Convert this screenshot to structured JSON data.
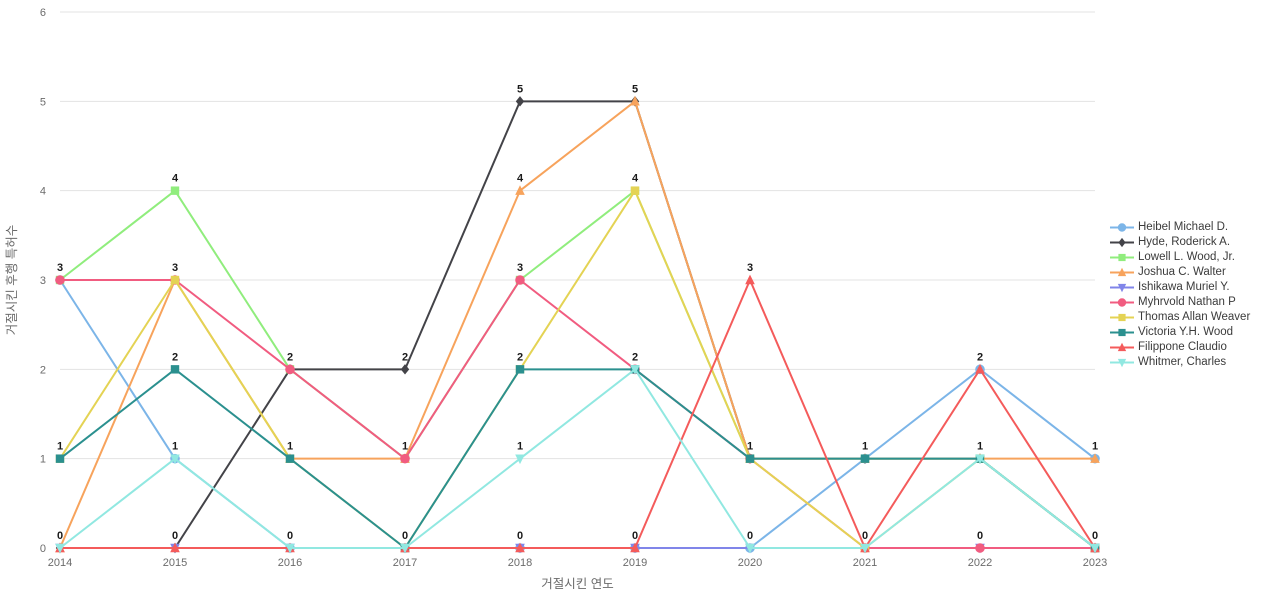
{
  "chart_data": {
    "type": "line",
    "title": "",
    "xlabel": "거절시킨 연도",
    "ylabel": "거절시킨 후행 특허수",
    "categories": [
      "2014",
      "2015",
      "2016",
      "2017",
      "2018",
      "2019",
      "2020",
      "2021",
      "2022",
      "2023"
    ],
    "ylim": [
      0,
      6
    ],
    "yticks": [
      0,
      1,
      2,
      3,
      4,
      5,
      6
    ],
    "grid": true,
    "legend_position": "right",
    "data_labels": true,
    "series": [
      {
        "name": "Heibel Michael D.",
        "color": "#7cb5e8",
        "marker": "circle",
        "values": [
          3,
          1,
          0,
          0,
          0,
          0,
          0,
          1,
          2,
          1
        ]
      },
      {
        "name": "Hyde, Roderick A.",
        "color": "#434348",
        "marker": "diamond",
        "values": [
          0,
          0,
          2,
          2,
          5,
          5,
          1,
          1,
          1,
          0
        ]
      },
      {
        "name": "Lowell L. Wood, Jr.",
        "color": "#90ed7d",
        "marker": "square",
        "values": [
          3,
          4,
          2,
          1,
          3,
          4,
          1,
          1,
          1,
          0
        ]
      },
      {
        "name": "Joshua C. Walter",
        "color": "#f7a35c",
        "marker": "triangle",
        "values": [
          0,
          3,
          1,
          1,
          4,
          5,
          1,
          1,
          1,
          1
        ]
      },
      {
        "name": "Ishikawa Muriel Y.",
        "color": "#8085e9",
        "marker": "triangle-down",
        "values": [
          0,
          0,
          0,
          0,
          0,
          0,
          0,
          0,
          0,
          0
        ]
      },
      {
        "name": "Myhrvold Nathan P",
        "color": "#f15c80",
        "marker": "circle",
        "values": [
          3,
          3,
          2,
          1,
          3,
          2,
          1,
          0,
          0,
          0
        ]
      },
      {
        "name": "Thomas Allan Weaver",
        "color": "#e4d354",
        "marker": "square",
        "values": [
          1,
          3,
          1,
          0,
          2,
          4,
          1,
          0,
          1,
          0
        ]
      },
      {
        "name": "Victoria Y.H. Wood",
        "color": "#2b908f",
        "marker": "square",
        "values": [
          1,
          2,
          1,
          0,
          2,
          2,
          1,
          1,
          1,
          0
        ]
      },
      {
        "name": "Filippone Claudio",
        "color": "#f45b5b",
        "marker": "triangle",
        "values": [
          0,
          0,
          0,
          0,
          0,
          0,
          3,
          0,
          2,
          0
        ]
      },
      {
        "name": "Whitmer, Charles",
        "color": "#91e8e1",
        "marker": "triangle-down",
        "values": [
          0,
          1,
          0,
          0,
          1,
          2,
          0,
          0,
          1,
          0
        ]
      }
    ],
    "point_labels": [
      {
        "x": "2014",
        "labels": [
          "3",
          "1",
          "0"
        ]
      },
      {
        "x": "2015",
        "labels": [
          "4",
          "3",
          "2",
          "1",
          "0"
        ]
      },
      {
        "x": "2016",
        "labels": [
          "2",
          "1",
          "0"
        ]
      },
      {
        "x": "2017",
        "labels": [
          "2",
          "1",
          "0"
        ]
      },
      {
        "x": "2018",
        "labels": [
          "5",
          "4",
          "3",
          "2",
          "1",
          "0"
        ]
      },
      {
        "x": "2019",
        "labels": [
          "5",
          "4",
          "2",
          "0"
        ]
      },
      {
        "x": "2020",
        "labels": [
          "3",
          "1",
          "0"
        ]
      },
      {
        "x": "2021",
        "labels": [
          "1",
          "0"
        ]
      },
      {
        "x": "2022",
        "labels": [
          "2",
          "1"
        ]
      },
      {
        "x": "2023",
        "labels": [
          "1",
          "0"
        ]
      }
    ]
  },
  "legend": {
    "items": [
      {
        "label": "Heibel Michael D."
      },
      {
        "label": "Hyde, Roderick A."
      },
      {
        "label": "Lowell L. Wood, Jr."
      },
      {
        "label": "Joshua C. Walter"
      },
      {
        "label": "Ishikawa Muriel Y."
      },
      {
        "label": "Myhrvold Nathan P"
      },
      {
        "label": "Thomas Allan Weaver"
      },
      {
        "label": "Victoria Y.H. Wood"
      },
      {
        "label": "Filippone Claudio"
      },
      {
        "label": "Whitmer, Charles"
      }
    ]
  },
  "axes": {
    "x_title": "거절시킨 연도",
    "y_title": "거절시킨 후행 특허수",
    "x_ticks": [
      "2014",
      "2015",
      "2016",
      "2017",
      "2018",
      "2019",
      "2020",
      "2021",
      "2022",
      "2023"
    ],
    "y_ticks": [
      "0",
      "1",
      "2",
      "3",
      "4",
      "5",
      "6"
    ]
  }
}
